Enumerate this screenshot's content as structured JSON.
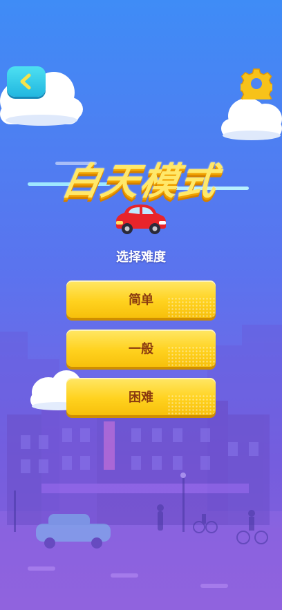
{
  "header": {
    "back_icon": "chevron-left-icon",
    "settings_icon": "gear-icon"
  },
  "title": "白天模式",
  "subtitle": "选择难度",
  "difficulty_options": [
    {
      "label": "简单"
    },
    {
      "label": "一般"
    },
    {
      "label": "困难"
    }
  ],
  "colors": {
    "button_fill": "#ffd21f",
    "button_text": "#8a3a10",
    "title_fill": "#ffe86a",
    "back_button": "#22b7e0",
    "gear": "#f7c21a"
  }
}
